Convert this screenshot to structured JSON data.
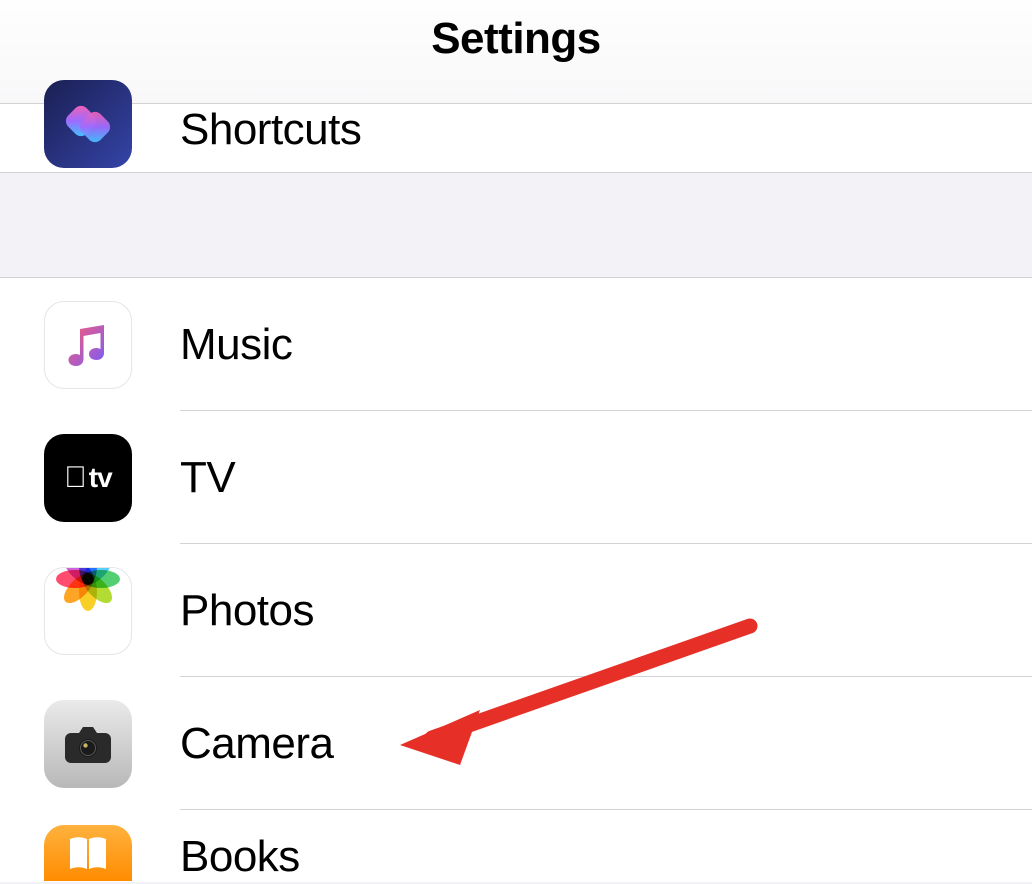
{
  "header": {
    "title": "Settings"
  },
  "groups": [
    {
      "items": [
        {
          "id": "shortcuts",
          "label": "Shortcuts",
          "icon": "shortcuts-icon"
        }
      ]
    },
    {
      "items": [
        {
          "id": "music",
          "label": "Music",
          "icon": "music-icon"
        },
        {
          "id": "tv",
          "label": "TV",
          "icon": "tv-icon"
        },
        {
          "id": "photos",
          "label": "Photos",
          "icon": "photos-icon"
        },
        {
          "id": "camera",
          "label": "Camera",
          "icon": "camera-icon"
        },
        {
          "id": "books",
          "label": "Books",
          "icon": "books-icon"
        }
      ]
    }
  ],
  "annotation": {
    "type": "arrow",
    "target": "camera",
    "color": "#e63027"
  }
}
